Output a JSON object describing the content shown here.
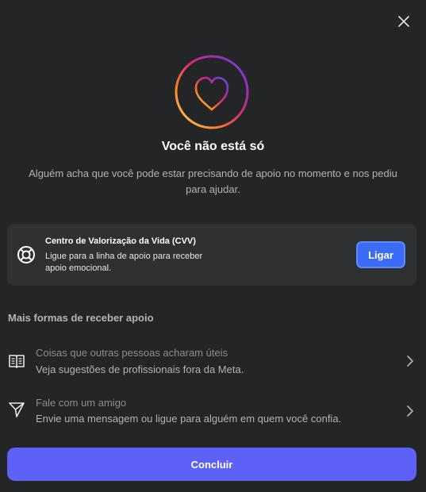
{
  "dialog": {
    "close_icon": "close-icon",
    "hero_icon": "heart-circle-icon",
    "title": "Você não está só",
    "subtitle": "Alguém acha que você pode estar precisando de apoio no momento e nos pediu para ajudar."
  },
  "cvv_card": {
    "icon": "lifebuoy-icon",
    "title": "Centro de Valorização da Vida (CVV)",
    "description": "Ligue para a linha de apoio para receber apoio emocional.",
    "call_label": "Ligar"
  },
  "more_support": {
    "heading": "Mais formas de receber apoio",
    "options": [
      {
        "icon": "book-icon",
        "title": "Coisas que outras pessoas acharam úteis",
        "description": "Veja sugestões de profissionais fora da Meta."
      },
      {
        "icon": "send-icon",
        "title": "Fale com um amigo",
        "description": "Envie uma mensagem ou ligue para alguém em quem você confia."
      }
    ]
  },
  "footer": {
    "done_label": "Concluir"
  },
  "colors": {
    "background": "#242526",
    "card": "#2f3031",
    "call_button": "#3b6cf6",
    "primary_button": "#5e61f7"
  }
}
